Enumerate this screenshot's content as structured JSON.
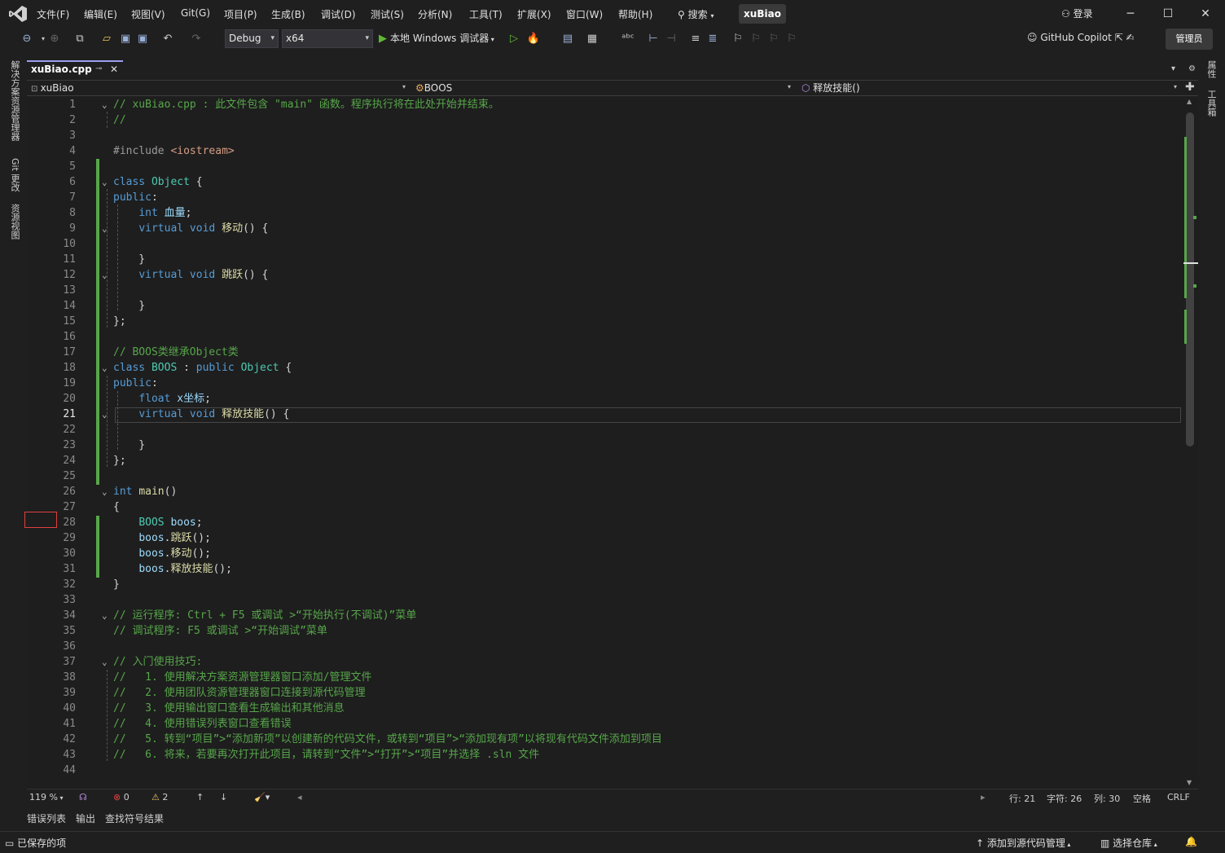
{
  "menu": {
    "items": [
      "文件(F)",
      "编辑(E)",
      "视图(V)",
      "Git(G)",
      "项目(P)",
      "生成(B)",
      "调试(D)",
      "测试(S)",
      "分析(N)",
      "工具(T)",
      "扩展(X)",
      "窗口(W)",
      "帮助(H)"
    ],
    "search_label": "搜索",
    "solution_name": "xuBiao",
    "login_label": "登录"
  },
  "toolbar": {
    "config": "Debug",
    "platform": "x64",
    "run_label": "本地 Windows 调试器",
    "copilot_label": "GitHub Copilot",
    "admin_label": "管理员"
  },
  "left_rail": {
    "tabs": [
      "解决方案资源管理器",
      "Git 更改",
      "资源视图"
    ]
  },
  "right_rail": {
    "tabs": [
      "属性",
      "工具箱"
    ]
  },
  "tab": {
    "file_name": "xuBiao.cpp"
  },
  "navbar": {
    "project": "xuBiao",
    "scope": "BOOS",
    "member": "释放技能()"
  },
  "editor": {
    "lines": [
      {
        "n": "1",
        "fold": "⌄",
        "tokens": [
          {
            "c": "t-com",
            "t": "// xuBiao.cpp : 此文件包含 \"main\" 函数。程序执行将在此处开始并结束。"
          }
        ]
      },
      {
        "n": "2",
        "fold": "",
        "tokens": [
          {
            "c": "t-com",
            "t": "//"
          }
        ]
      },
      {
        "n": "3",
        "fold": "",
        "tokens": []
      },
      {
        "n": "4",
        "fold": "",
        "tokens": [
          {
            "c": "t-pp",
            "t": "#include "
          },
          {
            "c": "t-str",
            "t": "<iostream>"
          }
        ]
      },
      {
        "n": "5",
        "fold": "",
        "tokens": []
      },
      {
        "n": "6",
        "fold": "⌄",
        "tokens": [
          {
            "c": "t-kw",
            "t": "class "
          },
          {
            "c": "t-cls",
            "t": "Object"
          },
          {
            "c": "t-p",
            "t": " {"
          }
        ]
      },
      {
        "n": "7",
        "fold": "",
        "tokens": [
          {
            "c": "t-kw",
            "t": "public"
          },
          {
            "c": "t-p",
            "t": ":"
          }
        ]
      },
      {
        "n": "8",
        "fold": "",
        "tokens": [
          {
            "c": "t-p",
            "t": "    "
          },
          {
            "c": "t-kw",
            "t": "int "
          },
          {
            "c": "t-var",
            "t": "血量"
          },
          {
            "c": "t-p",
            "t": ";"
          }
        ]
      },
      {
        "n": "9",
        "fold": "⌄",
        "tokens": [
          {
            "c": "t-p",
            "t": "    "
          },
          {
            "c": "t-kw",
            "t": "virtual void "
          },
          {
            "c": "t-fn",
            "t": "移动"
          },
          {
            "c": "t-p",
            "t": "() {"
          }
        ]
      },
      {
        "n": "10",
        "fold": "",
        "tokens": []
      },
      {
        "n": "11",
        "fold": "",
        "tokens": [
          {
            "c": "t-p",
            "t": "    }"
          }
        ]
      },
      {
        "n": "12",
        "fold": "⌄",
        "tokens": [
          {
            "c": "t-p",
            "t": "    "
          },
          {
            "c": "t-kw",
            "t": "virtual void "
          },
          {
            "c": "t-fn",
            "t": "跳跃"
          },
          {
            "c": "t-p",
            "t": "() {"
          }
        ]
      },
      {
        "n": "13",
        "fold": "",
        "tokens": []
      },
      {
        "n": "14",
        "fold": "",
        "tokens": [
          {
            "c": "t-p",
            "t": "    }"
          }
        ]
      },
      {
        "n": "15",
        "fold": "",
        "tokens": [
          {
            "c": "t-p",
            "t": "};"
          }
        ]
      },
      {
        "n": "16",
        "fold": "",
        "tokens": []
      },
      {
        "n": "17",
        "fold": "",
        "tokens": [
          {
            "c": "t-com",
            "t": "// BOOS类继承Object类"
          }
        ]
      },
      {
        "n": "18",
        "fold": "⌄",
        "tokens": [
          {
            "c": "t-kw",
            "t": "class "
          },
          {
            "c": "t-cls",
            "t": "BOOS"
          },
          {
            "c": "t-p",
            "t": " : "
          },
          {
            "c": "t-kw",
            "t": "public "
          },
          {
            "c": "t-cls",
            "t": "Object"
          },
          {
            "c": "t-p",
            "t": " {"
          }
        ]
      },
      {
        "n": "19",
        "fold": "",
        "tokens": [
          {
            "c": "t-kw",
            "t": "public"
          },
          {
            "c": "t-p",
            "t": ":"
          }
        ]
      },
      {
        "n": "20",
        "fold": "",
        "tokens": [
          {
            "c": "t-p",
            "t": "    "
          },
          {
            "c": "t-kw",
            "t": "float "
          },
          {
            "c": "t-var",
            "t": "x坐标"
          },
          {
            "c": "t-p",
            "t": ";"
          }
        ]
      },
      {
        "n": "21",
        "fold": "⌄",
        "tokens": [
          {
            "c": "t-p",
            "t": "    "
          },
          {
            "c": "t-kw",
            "t": "virtual void "
          },
          {
            "c": "t-fn",
            "t": "释放技能"
          },
          {
            "c": "t-p",
            "t": "() {"
          }
        ]
      },
      {
        "n": "22",
        "fold": "",
        "tokens": []
      },
      {
        "n": "23",
        "fold": "",
        "tokens": [
          {
            "c": "t-p",
            "t": "    }"
          }
        ]
      },
      {
        "n": "24",
        "fold": "",
        "tokens": [
          {
            "c": "t-p",
            "t": "};"
          }
        ]
      },
      {
        "n": "25",
        "fold": "",
        "tokens": []
      },
      {
        "n": "26",
        "fold": "⌄",
        "tokens": [
          {
            "c": "t-kw",
            "t": "int "
          },
          {
            "c": "t-fn",
            "t": "main"
          },
          {
            "c": "t-p",
            "t": "()"
          }
        ]
      },
      {
        "n": "27",
        "fold": "",
        "tokens": [
          {
            "c": "t-p",
            "t": "{"
          }
        ]
      },
      {
        "n": "28",
        "fold": "",
        "tokens": [
          {
            "c": "t-p",
            "t": "    "
          },
          {
            "c": "t-cls",
            "t": "BOOS"
          },
          {
            "c": "t-p",
            "t": " "
          },
          {
            "c": "t-var",
            "t": "boos"
          },
          {
            "c": "t-p",
            "t": ";"
          }
        ]
      },
      {
        "n": "29",
        "fold": "",
        "tokens": [
          {
            "c": "t-p",
            "t": "    "
          },
          {
            "c": "t-var",
            "t": "boos"
          },
          {
            "c": "t-p",
            "t": "."
          },
          {
            "c": "t-fn",
            "t": "跳跃"
          },
          {
            "c": "t-p",
            "t": "();"
          }
        ]
      },
      {
        "n": "30",
        "fold": "",
        "tokens": [
          {
            "c": "t-p",
            "t": "    "
          },
          {
            "c": "t-var",
            "t": "boos"
          },
          {
            "c": "t-p",
            "t": "."
          },
          {
            "c": "t-fn",
            "t": "移动"
          },
          {
            "c": "t-p",
            "t": "();"
          }
        ]
      },
      {
        "n": "31",
        "fold": "",
        "tokens": [
          {
            "c": "t-p",
            "t": "    "
          },
          {
            "c": "t-var",
            "t": "boos"
          },
          {
            "c": "t-p",
            "t": "."
          },
          {
            "c": "t-fn",
            "t": "释放技能"
          },
          {
            "c": "t-p",
            "t": "();"
          }
        ]
      },
      {
        "n": "32",
        "fold": "",
        "tokens": [
          {
            "c": "t-p",
            "t": "}"
          }
        ]
      },
      {
        "n": "33",
        "fold": "",
        "tokens": []
      },
      {
        "n": "34",
        "fold": "⌄",
        "tokens": [
          {
            "c": "t-com",
            "t": "// 运行程序: Ctrl + F5 或调试 >“开始执行(不调试)”菜单"
          }
        ]
      },
      {
        "n": "35",
        "fold": "",
        "tokens": [
          {
            "c": "t-com",
            "t": "// 调试程序: F5 或调试 >“开始调试”菜单"
          }
        ]
      },
      {
        "n": "36",
        "fold": "",
        "tokens": []
      },
      {
        "n": "37",
        "fold": "⌄",
        "tokens": [
          {
            "c": "t-com",
            "t": "// 入门使用技巧:"
          }
        ]
      },
      {
        "n": "38",
        "fold": "",
        "tokens": [
          {
            "c": "t-com",
            "t": "//   1. 使用解决方案资源管理器窗口添加/管理文件"
          }
        ]
      },
      {
        "n": "39",
        "fold": "",
        "tokens": [
          {
            "c": "t-com",
            "t": "//   2. 使用团队资源管理器窗口连接到源代码管理"
          }
        ]
      },
      {
        "n": "40",
        "fold": "",
        "tokens": [
          {
            "c": "t-com",
            "t": "//   3. 使用输出窗口查看生成输出和其他消息"
          }
        ]
      },
      {
        "n": "41",
        "fold": "",
        "tokens": [
          {
            "c": "t-com",
            "t": "//   4. 使用错误列表窗口查看错误"
          }
        ]
      },
      {
        "n": "42",
        "fold": "",
        "tokens": [
          {
            "c": "t-com",
            "t": "//   5. 转到“项目”>“添加新项”以创建新的代码文件，或转到“项目”>“添加现有项”以将现有代码文件添加到项目"
          }
        ]
      },
      {
        "n": "43",
        "fold": "",
        "tokens": [
          {
            "c": "t-com",
            "t": "//   6. 将来，若要再次打开此项目，请转到“文件”>“打开”>“项目”并选择 .sln 文件"
          }
        ]
      },
      {
        "n": "44",
        "fold": "",
        "tokens": []
      }
    ],
    "current_line": "21"
  },
  "editor_status": {
    "zoom": "119 %",
    "errors": "0",
    "warnings": "2",
    "line": "行: 21",
    "char": "字符: 26",
    "col": "列: 30",
    "whitespace": "空格",
    "eol": "CRLF"
  },
  "panel_tabs": [
    "错误列表",
    "输出",
    "查找符号结果"
  ],
  "statusbar": {
    "saved": "已保存的项",
    "source_control": "添加到源代码管理",
    "repo": "选择仓库"
  },
  "colors": {
    "accent": "#9a9ef0",
    "run_green": "#5fb832",
    "change_bar": "#57a64a",
    "error_red": "#e04040"
  }
}
